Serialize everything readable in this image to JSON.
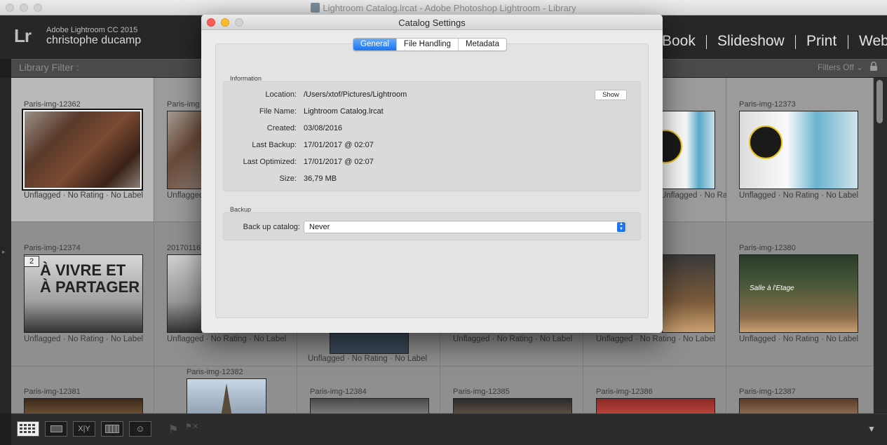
{
  "window": {
    "title": "Lightroom Catalog.lrcat - Adobe Photoshop Lightroom - Library"
  },
  "identity": {
    "logo": "Lr",
    "app": "Adobe Lightroom CC 2015",
    "user": "christophe ducamp"
  },
  "modules": [
    "Book",
    "Slideshow",
    "Print",
    "Web"
  ],
  "filter": {
    "title": "Library Filter :",
    "status": "Filters Off"
  },
  "grid": {
    "meta": "Unflagged · No Rating · No Label",
    "cells": [
      {
        "name": "Paris-img-12362"
      },
      {
        "name": "Paris-img-12373"
      },
      {
        "name": "Paris-img-12374",
        "stack": "2"
      },
      {
        "name": "Paris-img-12380"
      },
      {
        "name": "Paris-img-12381"
      },
      {
        "name": "Paris-img-12382"
      },
      {
        "name": "Paris-img-12384"
      },
      {
        "name": "Paris-img-12385"
      },
      {
        "name": "Paris-img-12386"
      },
      {
        "name": "Paris-img-12387"
      }
    ],
    "partial": {
      "col2_name": "Paris-img",
      "row2_col2_name": "20170116"
    }
  },
  "dialog": {
    "title": "Catalog Settings",
    "tabs": [
      "General",
      "File Handling",
      "Metadata"
    ],
    "active_tab": "General",
    "info_label": "Information",
    "fields": [
      {
        "label": "Location:",
        "value": "/Users/xtof/Pictures/Lightroom"
      },
      {
        "label": "File Name:",
        "value": "Lightroom Catalog.lrcat"
      },
      {
        "label": "Created:",
        "value": "03/08/2016"
      },
      {
        "label": "Last Backup:",
        "value": "17/01/2017 @ 02:07"
      },
      {
        "label": "Last Optimized:",
        "value": "17/01/2017 @ 02:07"
      },
      {
        "label": "Size:",
        "value": "36,79 MB"
      }
    ],
    "show_button": "Show",
    "backup_label": "Backup",
    "backup_field_label": "Back up catalog:",
    "backup_value": "Never"
  },
  "toolbar": {
    "icons": [
      "grid-view-icon",
      "loupe-view-icon",
      "compare-view-icon",
      "survey-view-icon",
      "people-view-icon",
      "flag-icon",
      "reject-flag-icon",
      "toolbar-menu-icon"
    ]
  }
}
